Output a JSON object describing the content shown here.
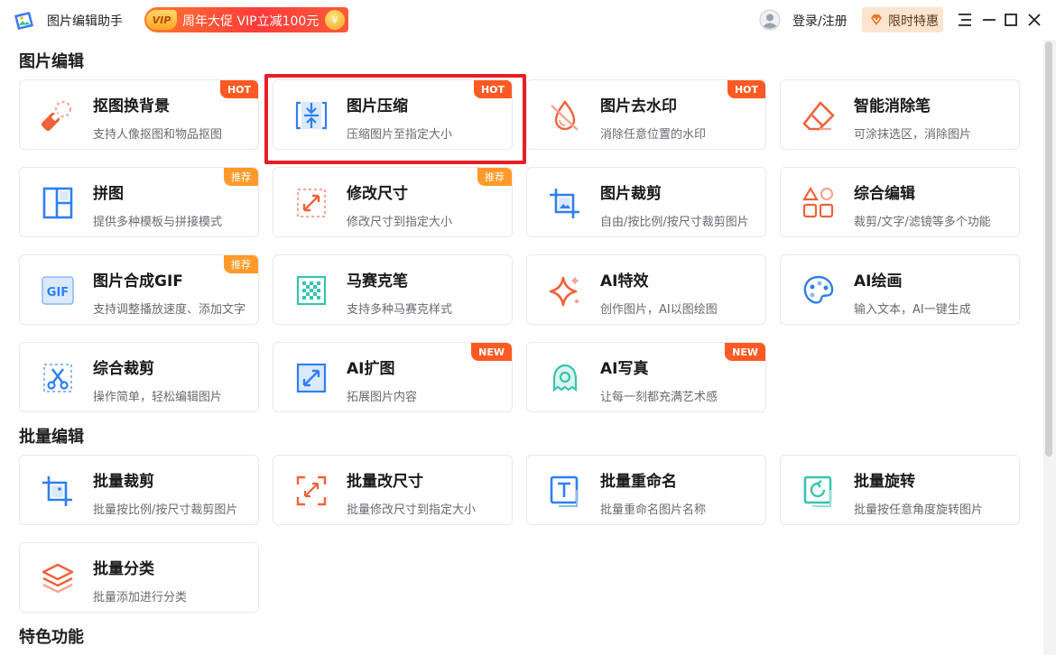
{
  "app": {
    "title": "图片编辑助手",
    "promo_vip": "VIP",
    "promo_text": "周年大促 VIP立减100元",
    "promo_coin": "¥",
    "login": "登录/注册",
    "limited_offer": "限时特惠"
  },
  "colors": {
    "accent_blue": "#2f7ff0",
    "accent_orange": "#f0623a",
    "hot_badge": "#ff5a24",
    "recommend_badge": "#ff9a2a",
    "highlight": "#ea1d24"
  },
  "sections": [
    {
      "title": "图片编辑"
    },
    {
      "title": "批量编辑"
    },
    {
      "title": "特色功能"
    }
  ],
  "cards": [
    {
      "title": "抠图换背景",
      "desc": "支持人像抠图和物品抠图",
      "badge": "HOT",
      "icon": "eraser-cutout-icon"
    },
    {
      "title": "图片压缩",
      "desc": "压缩图片至指定大小",
      "badge": "HOT",
      "icon": "compress-icon"
    },
    {
      "title": "图片去水印",
      "desc": "消除任意位置的水印",
      "badge": "HOT",
      "icon": "watermark-remove-icon"
    },
    {
      "title": "智能消除笔",
      "desc": "可涂抹选区，消除图片",
      "badge": "",
      "icon": "eraser-icon"
    },
    {
      "title": "拼图",
      "desc": "提供多种模板与拼接模式",
      "badge": "推荐",
      "icon": "collage-icon"
    },
    {
      "title": "修改尺寸",
      "desc": "修改尺寸到指定大小",
      "badge": "推荐",
      "icon": "resize-icon"
    },
    {
      "title": "图片裁剪",
      "desc": "自由/按比例/按尺寸裁剪图片",
      "badge": "",
      "icon": "crop-icon"
    },
    {
      "title": "综合编辑",
      "desc": "裁剪/文字/滤镜等多个功能",
      "badge": "",
      "icon": "shapes-icon"
    },
    {
      "title": "图片合成GIF",
      "desc": "支持调整播放速度、添加文字",
      "badge": "推荐",
      "icon": "gif-icon"
    },
    {
      "title": "马赛克笔",
      "desc": "支持多种马赛克样式",
      "badge": "",
      "icon": "mosaic-icon"
    },
    {
      "title": "AI特效",
      "desc": "创作图片，AI以图绘图",
      "badge": "",
      "icon": "sparkle-icon"
    },
    {
      "title": "AI绘画",
      "desc": "输入文本，AI一键生成",
      "badge": "",
      "icon": "palette-icon"
    },
    {
      "title": "综合裁剪",
      "desc": "操作简单，轻松编辑图片",
      "badge": "",
      "icon": "scissors-icon"
    },
    {
      "title": "AI扩图",
      "desc": "拓展图片内容",
      "badge": "NEW",
      "icon": "expand-icon"
    },
    {
      "title": "AI写真",
      "desc": "让每一刻都充满艺术感",
      "badge": "NEW",
      "icon": "portrait-icon"
    },
    {
      "title": "批量裁剪",
      "desc": "批量按比例/按尺寸裁剪图片",
      "badge": "",
      "icon": "batch-crop-icon"
    },
    {
      "title": "批量改尺寸",
      "desc": "批量修改尺寸到指定大小",
      "badge": "",
      "icon": "batch-resize-icon"
    },
    {
      "title": "批量重命名",
      "desc": "批量重命名图片名称",
      "badge": "",
      "icon": "rename-icon"
    },
    {
      "title": "批量旋转",
      "desc": "批量按任意角度旋转图片",
      "badge": "",
      "icon": "rotate-icon"
    },
    {
      "title": "批量分类",
      "desc": "批量添加进行分类",
      "badge": "",
      "icon": "layers-icon"
    }
  ]
}
